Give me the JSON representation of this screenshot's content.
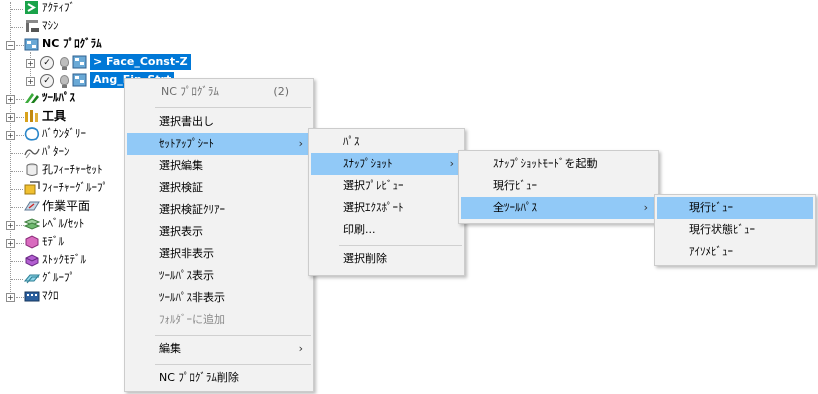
{
  "tree": {
    "items": [
      {
        "label": "ｱｸﾃｨﾌﾞ",
        "icon": "active-arrow-icon"
      },
      {
        "label": "ﾏｼﾝ",
        "icon": "machine-icon"
      },
      {
        "label": "NC ﾌﾟﾛｸﾞﾗﾑ",
        "icon": "nc-program-icon"
      },
      {
        "label": "> Face_Const-Z",
        "icon": "nc-file-icon"
      },
      {
        "label": "Ang_Fin_Strt",
        "icon": "nc-file-icon"
      },
      {
        "label": "ﾂｰﾙﾊﾟｽ",
        "icon": "toolpath-icon"
      },
      {
        "label": "工具",
        "icon": "tool-icon"
      },
      {
        "label": "ﾊﾞｳﾝﾀﾞﾘｰ",
        "icon": "boundary-icon"
      },
      {
        "label": "ﾊﾟﾀｰﾝ",
        "icon": "pattern-icon"
      },
      {
        "label": "孔ﾌｨｰﾁｬｰｾｯﾄ",
        "icon": "hole-feature-icon"
      },
      {
        "label": "ﾌｨｰﾁｬｰｸﾞﾙｰﾌﾟ",
        "icon": "feature-group-icon"
      },
      {
        "label": "作業平面",
        "icon": "workplane-icon"
      },
      {
        "label": "ﾚﾍﾞﾙ/ｾｯﾄ",
        "icon": "level-set-icon"
      },
      {
        "label": "ﾓﾃﾞﾙ",
        "icon": "model-icon"
      },
      {
        "label": "ｽﾄｯｸﾓﾃﾞﾙ",
        "icon": "stock-model-icon"
      },
      {
        "label": "ｸﾞﾙｰﾌﾟ",
        "icon": "group-icon"
      },
      {
        "label": "ﾏｸﾛ",
        "icon": "macro-icon"
      }
    ]
  },
  "context_menu": {
    "header": "NC ﾌﾟﾛｸﾞﾗﾑ",
    "header_count": "(2)",
    "items": [
      "選択書出し",
      "ｾｯﾄｱｯﾌﾟｼｰﾄ",
      "選択編集",
      "選択検証",
      "選択検証ｸﾘｱｰ",
      "選択表示",
      "選択非表示",
      "ﾂｰﾙﾊﾟｽ表示",
      "ﾂｰﾙﾊﾟｽ非表示",
      "ﾌｫﾙﾀﾞｰに追加",
      "編集",
      "NC ﾌﾟﾛｸﾞﾗﾑ削除"
    ]
  },
  "setup_sheet_menu": {
    "items": [
      "ﾊﾟｽ",
      "ｽﾅｯﾌﾟｼｮｯﾄ",
      "選択ﾌﾟﾚﾋﾞｭｰ",
      "選択ｴｸｽﾎﾟｰﾄ",
      "印刷...",
      "選択削除"
    ]
  },
  "snapshot_menu": {
    "items": [
      "ｽﾅｯﾌﾟｼｮｯﾄﾓｰﾄﾞを起動",
      "現行ﾋﾞｭｰ",
      "全ﾂｰﾙﾊﾟｽ"
    ]
  },
  "all_toolpaths_menu": {
    "items": [
      "現行ﾋﾞｭｰ",
      "現行状態ﾋﾞｭｰ",
      "ｱｲｿﾒﾋﾞｭｰ"
    ]
  },
  "colors": {
    "selection": "#0078d7",
    "menu_highlight": "#91c9f7",
    "menu_background": "#f2f2f2"
  }
}
